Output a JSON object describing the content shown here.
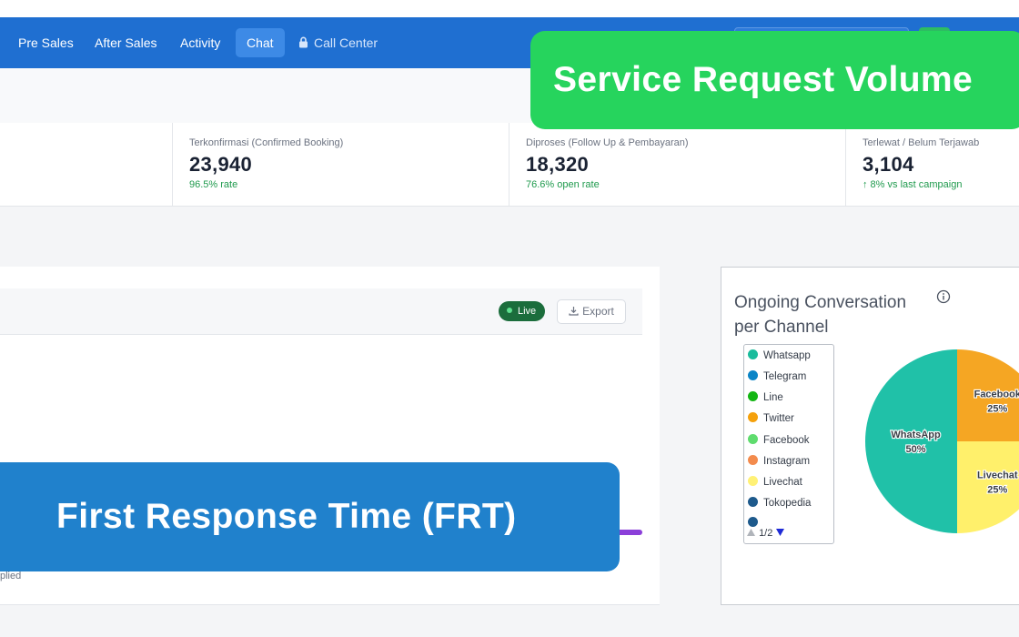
{
  "nav": {
    "items": [
      {
        "label": "Pre Sales"
      },
      {
        "label": "After Sales"
      },
      {
        "label": "Activity"
      },
      {
        "label": "Chat"
      },
      {
        "label": "Call Center"
      }
    ],
    "active": "Chat"
  },
  "stats": [
    {
      "label": "Terkonfirmasi (Confirmed Booking)",
      "value": "23,940",
      "sub": "96.5% rate"
    },
    {
      "label": "Diproses (Follow Up & Pembayaran)",
      "value": "18,320",
      "sub": "76.6% open rate"
    },
    {
      "label": "Terlewat / Belum Terjawab",
      "value": "3,104",
      "sub": "↑ 8% vs last campaign"
    }
  ],
  "frt_panel": {
    "live_label": "Live",
    "export_label": "Export",
    "footnote": "plied"
  },
  "channel_panel": {
    "title": "Ongoing Conversation per Channel",
    "legend_items": [
      {
        "label": "Whatsapp",
        "color": "#1abc9c"
      },
      {
        "label": "Telegram",
        "color": "#0a84c6"
      },
      {
        "label": "Line",
        "color": "#13b613"
      },
      {
        "label": "Twitter",
        "color": "#f5a10c"
      },
      {
        "label": "Facebook",
        "color": "#5fdc6e"
      },
      {
        "label": "Instagram",
        "color": "#f38b4d"
      },
      {
        "label": "Livechat",
        "color": "#fff176"
      },
      {
        "label": "Tokopedia",
        "color": "#1e5a8c"
      }
    ],
    "pager": "1/2"
  },
  "chart_data": {
    "type": "pie",
    "title": "Ongoing Conversation per Channel",
    "slices": [
      {
        "label": "WhatsApp",
        "value": 50,
        "display": "50%",
        "color": "#20c1a8"
      },
      {
        "label": "Facebook",
        "value": 25,
        "display": "25%",
        "color": "#f5a623"
      },
      {
        "label": "Livechat",
        "value": 25,
        "display": "25%",
        "color": "#fff06b"
      }
    ]
  },
  "callouts": {
    "top": "Service Request Volume",
    "bottom": "First Response Time (FRT)"
  }
}
